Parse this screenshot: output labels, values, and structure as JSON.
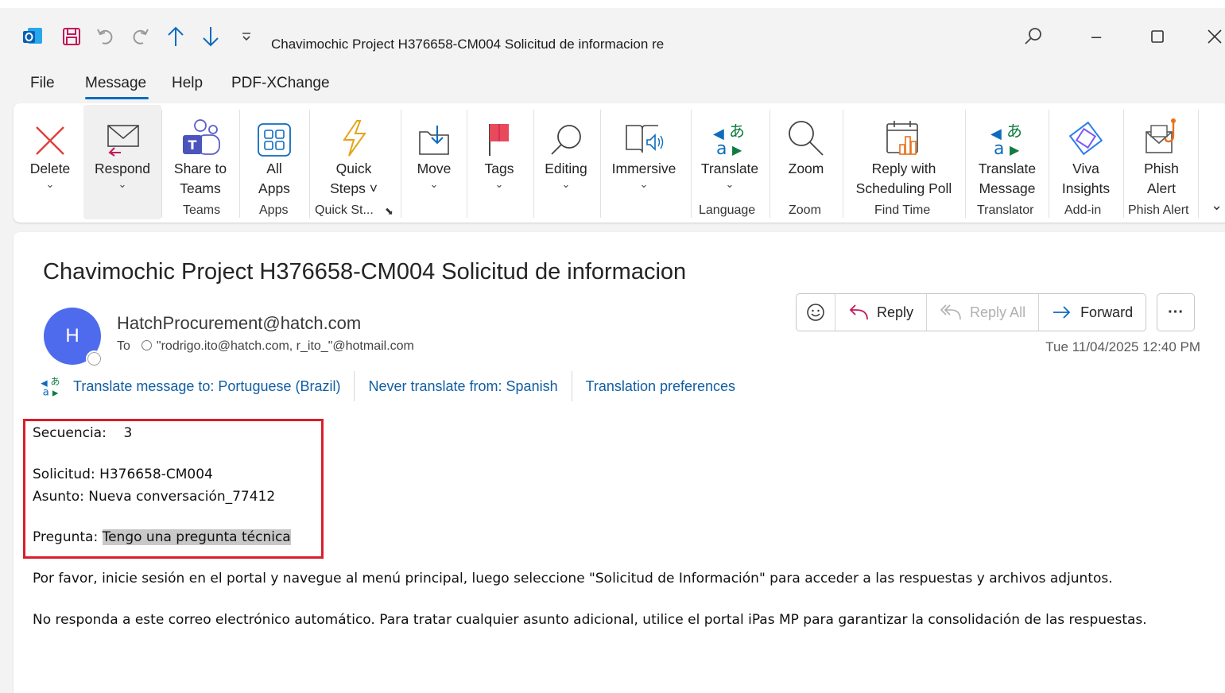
{
  "window": {
    "title": "Chavimochic Project  H376658-CM004 Solicitud de informacion re",
    "controls": {
      "minimize": "–",
      "maximize": "☐",
      "close": "✕"
    }
  },
  "menu": {
    "tabs": [
      "File",
      "Message",
      "Help",
      "PDF-XChange"
    ],
    "active": "Message"
  },
  "ribbon": {
    "delete": "Delete",
    "respond": "Respond",
    "share_teams_1": "Share to",
    "share_teams_2": "Teams",
    "all_apps_1": "All",
    "all_apps_2": "Apps",
    "quick_steps_1": "Quick",
    "quick_steps_2": "Steps",
    "move": "Move",
    "tags": "Tags",
    "editing": "Editing",
    "immersive": "Immersive",
    "translate": "Translate",
    "zoom": "Zoom",
    "reply_poll_1": "Reply with",
    "reply_poll_2": "Scheduling Poll",
    "translate_msg_1": "Translate",
    "translate_msg_2": "Message",
    "viva_1": "Viva",
    "viva_2": "Insights",
    "phish_1": "Phish",
    "phish_2": "Alert",
    "groups": {
      "teams": "Teams",
      "apps": "Apps",
      "quick_steps": "Quick St...",
      "language": "Language",
      "zoom": "Zoom",
      "find_time": "Find Time",
      "translator": "Translator",
      "addin": "Add-in",
      "phish_alert": "Phish Alert"
    }
  },
  "message": {
    "subject": "Chavimochic Project  H376658-CM004 Solicitud de informacion",
    "avatar_initial": "H",
    "sender": "HatchProcurement@hatch.com",
    "to_label": "To",
    "recipients": "\"rodrigo.ito@hatch.com, r_ito_\"@hotmail.com",
    "date": "Tue 11/04/2025 12:40 PM",
    "actions": {
      "reply": "Reply",
      "reply_all": "Reply All",
      "forward": "Forward",
      "more": "···"
    },
    "translation": {
      "translate_to": "Translate message to: Portuguese (Brazil)",
      "never_translate": "Never translate from: Spanish",
      "preferences": "Translation preferences"
    },
    "body": {
      "secuencia_label": "Secuencia:",
      "secuencia_value": "3",
      "solicitud": "Solicitud: H376658-CM004",
      "asunto": "Asunto: Nueva conversación_77412",
      "pregunta_label": "Pregunta:",
      "pregunta_value": "Tengo una pregunta técnica",
      "para1": "Por favor, inicie sesión en el portal y navegue al menú principal, luego seleccione \"Solicitud de Información\" para acceder a las respuestas y archivos adjuntos.",
      "para2": "No responda a este correo electrónico automático. Para tratar cualquier asunto adicional, utilice el portal iPas MP para garantizar la consolidación de las respuestas."
    }
  },
  "colors": {
    "accent": "#0f6cbd",
    "avatar": "#4f6bed",
    "highlight_box": "#d81e2b",
    "link": "#115ea3"
  }
}
